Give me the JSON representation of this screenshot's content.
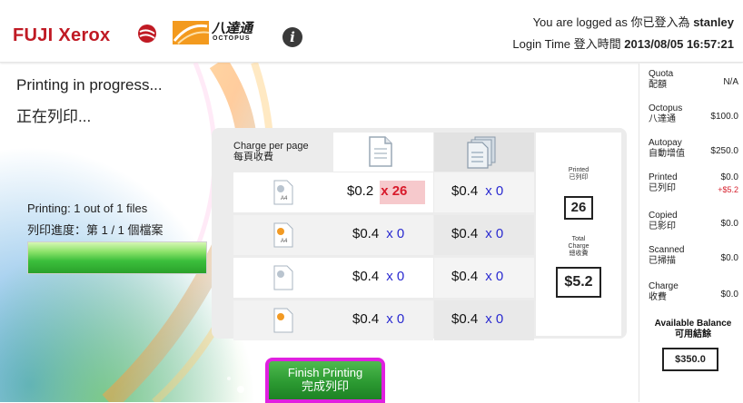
{
  "header": {
    "brand": "FUJI Xerox",
    "octopus_cn": "八達通",
    "octopus_en": "OCTOPUS",
    "info_glyph": "i",
    "logged_in_prefix": "You are logged as",
    "logged_in_prefix_cn": "你已登入為",
    "username": "stanley",
    "login_time_label": "Login Time",
    "login_time_label_cn": "登入時間",
    "login_time": "2013/08/05 16:57:21"
  },
  "status": {
    "title_en": "Printing in progress...",
    "title_cn": "正在列印...",
    "progress_en": "Printing: 1 out of 1 files",
    "progress_cn": "列印進度：第 1 / 1 個檔案",
    "progress_fraction": 1.0
  },
  "charge_table": {
    "header_label_en": "Charge per page",
    "header_label_cn": "每頁收費",
    "rows": [
      {
        "paper": "A4",
        "col1_price": "$0.2",
        "col1_mult": "x 26",
        "col2_price": "$0.4",
        "col2_mult": "x 0"
      },
      {
        "paper": "A4",
        "col1_price": "$0.4",
        "col1_mult": "x 0",
        "col2_price": "$0.4",
        "col2_mult": "x 0"
      },
      {
        "paper": "",
        "col1_price": "$0.4",
        "col1_mult": "x 0",
        "col2_price": "$0.4",
        "col2_mult": "x 0"
      },
      {
        "paper": "",
        "col1_price": "$0.4",
        "col1_mult": "x 0",
        "col2_price": "$0.4",
        "col2_mult": "x 0"
      }
    ],
    "printed_label_en": "Printed",
    "printed_label_cn": "已列印",
    "printed_count": "26",
    "total_label_en": "Total",
    "total_label_en2": "Charge",
    "total_label_cn": "總收費",
    "total_charge": "$5.2"
  },
  "right_panel": {
    "items": [
      {
        "label_en": "Quota",
        "label_cn": "配額",
        "value": "N/A"
      },
      {
        "label_en": "Octopus",
        "label_cn": "八達通",
        "value": "$100.0"
      },
      {
        "label_en": "Autopay",
        "label_cn": "自動增值",
        "value": "$250.0"
      },
      {
        "label_en": "Printed",
        "label_cn": "已列印",
        "value": "$0.0",
        "value2": "+$5.2"
      },
      {
        "label_en": "Copied",
        "label_cn": "已影印",
        "value": "$0.0"
      },
      {
        "label_en": "Scanned",
        "label_cn": "已掃描",
        "value": "$0.0"
      },
      {
        "label_en": "Charge",
        "label_cn": "收費",
        "value": "$0.0"
      }
    ],
    "available_label_en": "Available Balance",
    "available_label_cn": "可用結餘",
    "available_balance": "$350.0"
  },
  "finish_button": {
    "label_en": "Finish Printing",
    "label_cn": "完成列印"
  },
  "colors": {
    "brand_red": "#c01a24",
    "progress_green": "#3cbf3c",
    "highlight_border": "#e020e0",
    "multiplier_blue": "#2a2ad0",
    "multiplier_red": "#d81a2b"
  }
}
